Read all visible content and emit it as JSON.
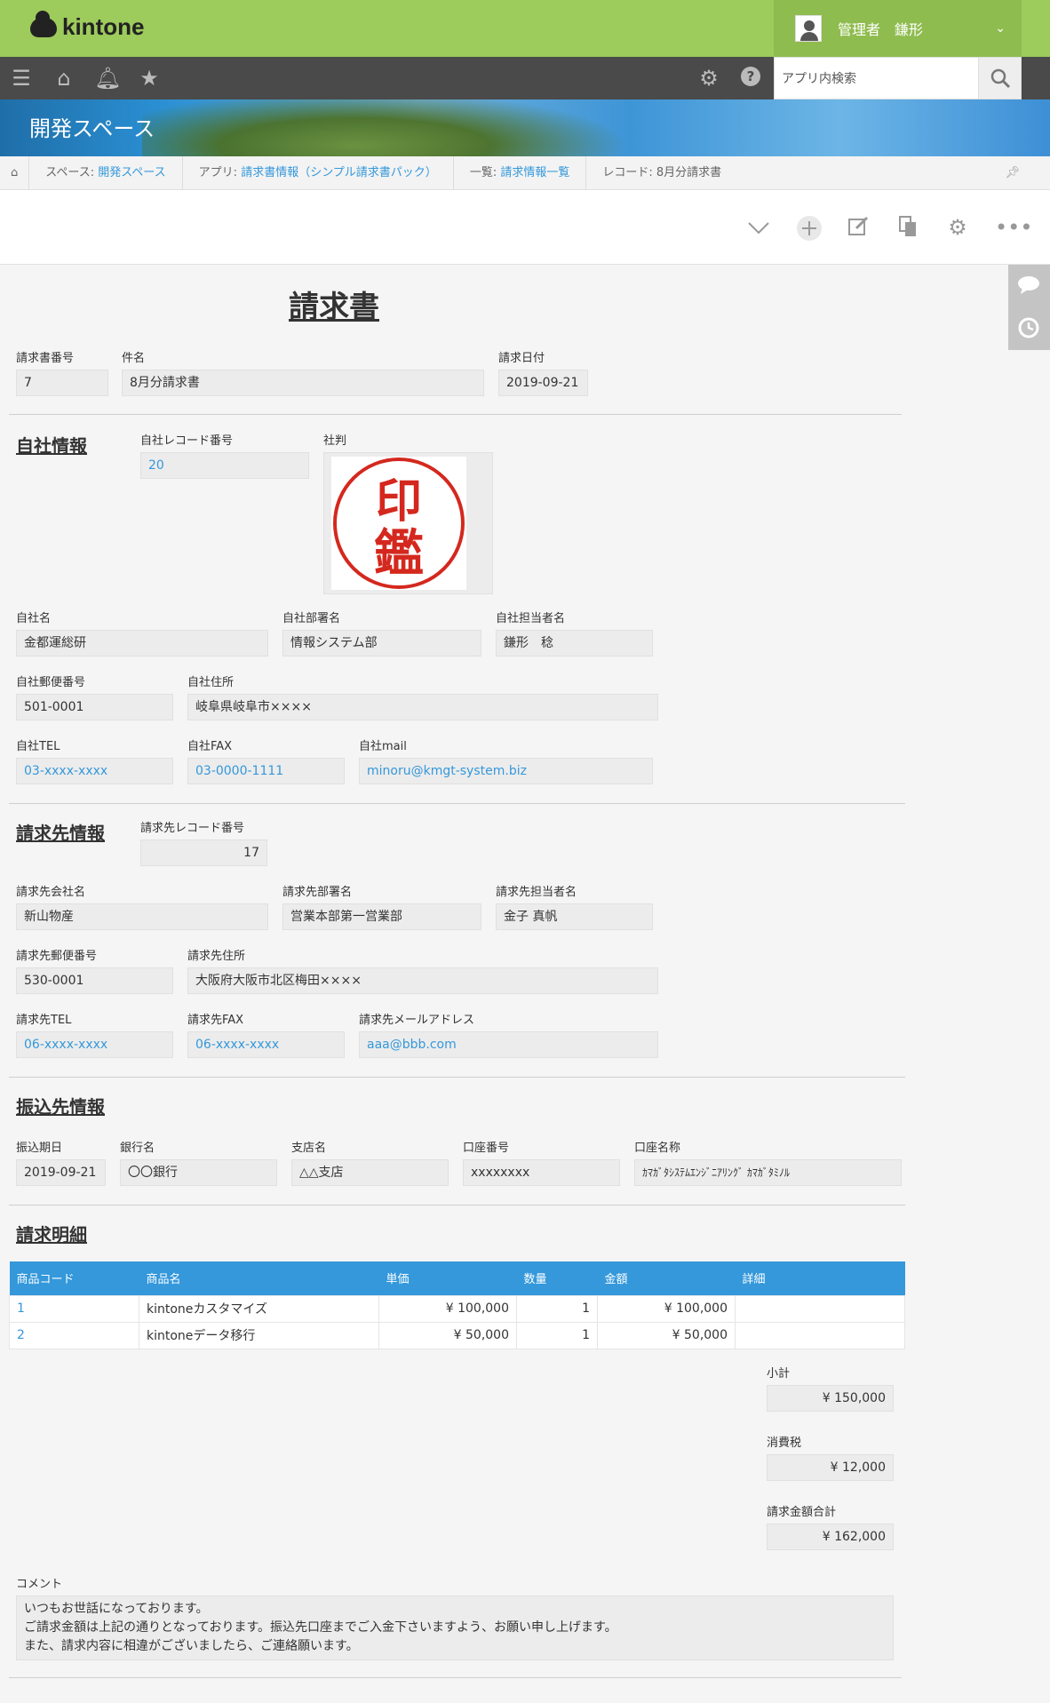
{
  "header": {
    "logo": "kintone",
    "user_name": "管理者　鎌形"
  },
  "search": {
    "placeholder": "アプリ内検索"
  },
  "space": {
    "title": "開発スペース"
  },
  "breadcrumb": {
    "space_prefix": "スペース: ",
    "space": "開発スペース",
    "app_prefix": "アプリ: ",
    "app": "請求書情報（シンプル請求書パック）",
    "list_prefix": "一覧: ",
    "list": "請求情報一覧",
    "record": "レコード: 8月分請求書"
  },
  "form": {
    "title": "請求書",
    "invoice_no_label": "請求書番号",
    "invoice_no": "7",
    "subject_label": "件名",
    "subject": "8月分請求書",
    "invoice_date_label": "請求日付",
    "invoice_date": "2019-09-21",
    "own": {
      "section": "自社情報",
      "record_no_label": "自社レコード番号",
      "record_no": "20",
      "seal_label": "社判",
      "seal_text_1": "印",
      "seal_text_2": "鑑",
      "name_label": "自社名",
      "name": "金都運総研",
      "dept_label": "自社部署名",
      "dept": "情報システム部",
      "person_label": "自社担当者名",
      "person": "鎌形　稔",
      "zip_label": "自社郵便番号",
      "zip": "501-0001",
      "addr_label": "自社住所",
      "addr": "岐阜県岐阜市××××",
      "tel_label": "自社TEL",
      "tel": "03-xxxx-xxxx",
      "fax_label": "自社FAX",
      "fax": "03-0000-1111",
      "mail_label": "自社mail",
      "mail": "minoru@kmgt-system.biz"
    },
    "client": {
      "section": "請求先情報",
      "record_no_label": "請求先レコード番号",
      "record_no": "17",
      "company_label": "請求先会社名",
      "company": "新山物産",
      "dept_label": "請求先部署名",
      "dept": "営業本部第一営業部",
      "person_label": "請求先担当者名",
      "person": "金子 真帆",
      "zip_label": "請求先郵便番号",
      "zip": "530-0001",
      "addr_label": "請求先住所",
      "addr": "大阪府大阪市北区梅田××××",
      "tel_label": "請求先TEL",
      "tel": "06-xxxx-xxxx",
      "fax_label": "請求先FAX",
      "fax": "06-xxxx-xxxx",
      "mail_label": "請求先メールアドレス",
      "mail": "aaa@bbb.com"
    },
    "bank": {
      "section": "振込先情報",
      "due_label": "振込期日",
      "due": "2019-09-21",
      "bank_label": "銀行名",
      "bank": "〇〇銀行",
      "branch_label": "支店名",
      "branch": "△△支店",
      "account_no_label": "口座番号",
      "account_no": "xxxxxxxx",
      "account_name_label": "口座名称",
      "account_name": "ｶﾏｶﾞﾀｼｽﾃﾑｴﾝｼﾞﾆｱﾘﾝｸﾞ ｶﾏｶﾞﾀﾐﾉﾙ"
    },
    "detail": {
      "section": "請求明細",
      "headers": [
        "商品コード",
        "商品名",
        "単価",
        "数量",
        "金額",
        "詳細"
      ],
      "rows": [
        {
          "code": "1",
          "name": "kintoneカスタマイズ",
          "price": "¥ 100,000",
          "qty": "1",
          "amount": "¥ 100,000",
          "note": ""
        },
        {
          "code": "2",
          "name": "kintoneデータ移行",
          "price": "¥ 50,000",
          "qty": "1",
          "amount": "¥ 50,000",
          "note": ""
        }
      ]
    },
    "subtotal_label": "小計",
    "subtotal": "¥ 150,000",
    "tax_label": "消費税",
    "tax": "¥ 12,000",
    "total_label": "請求金額合計",
    "total": "¥ 162,000",
    "comment_label": "コメント",
    "comment_lines": [
      "いつもお世話になっております。",
      "ご請求金額は上記の通りとなっております。振込先口座までご入金下さいますよう、お願い申し上げます。",
      "また、請求内容に相違がございましたら、ご連絡願います。"
    ]
  }
}
